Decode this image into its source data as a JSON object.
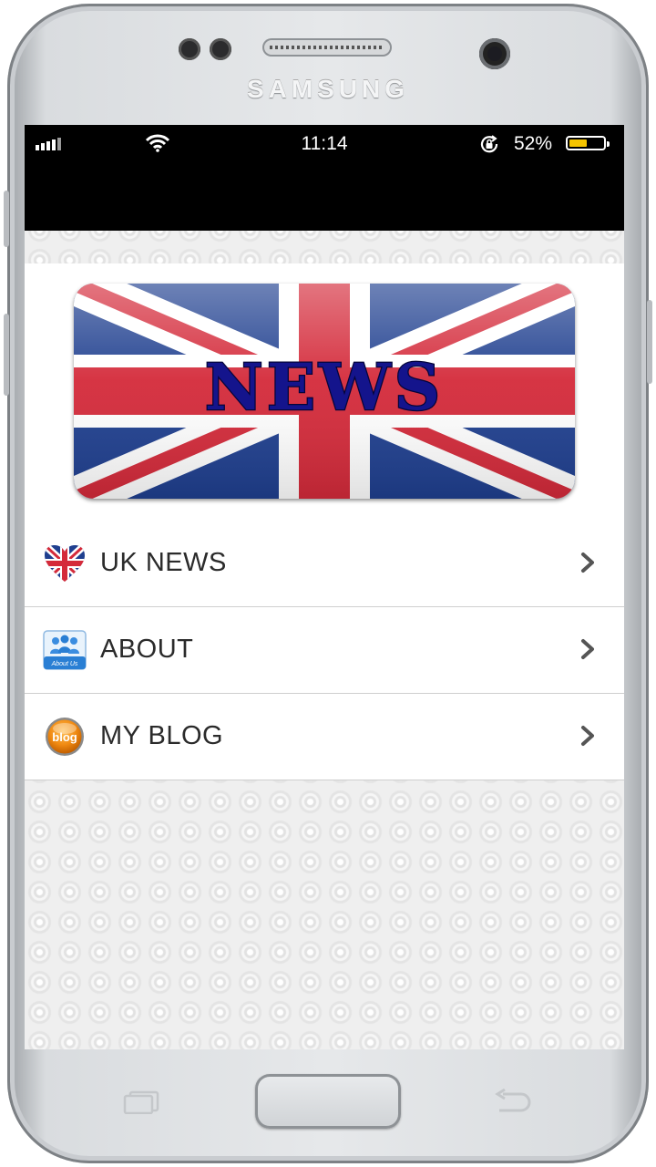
{
  "device": {
    "brand": "SAMSUNG"
  },
  "status_bar": {
    "time": "11:14",
    "battery_percent": "52%",
    "battery_level": 0.52,
    "icons": [
      "signal-icon",
      "wifi-icon",
      "rotation-lock-icon",
      "battery-icon"
    ]
  },
  "logo": {
    "text": "NEWS"
  },
  "menu": {
    "items": [
      {
        "label": "UK NEWS",
        "icon": "uk-heart-icon"
      },
      {
        "label": "ABOUT",
        "icon": "about-us-icon",
        "icon_text": "About Us"
      },
      {
        "label": "MY BLOG",
        "icon": "blog-icon",
        "icon_text": "blog"
      }
    ]
  },
  "colors": {
    "status_bar_bg": "#000000",
    "battery_fill": "#f5c400",
    "flag_blue": "#1f3f8f",
    "flag_red": "#d42a3a",
    "blog_orange": "#f08a12",
    "about_blue": "#2a7fd4",
    "chevron": "#555555"
  }
}
